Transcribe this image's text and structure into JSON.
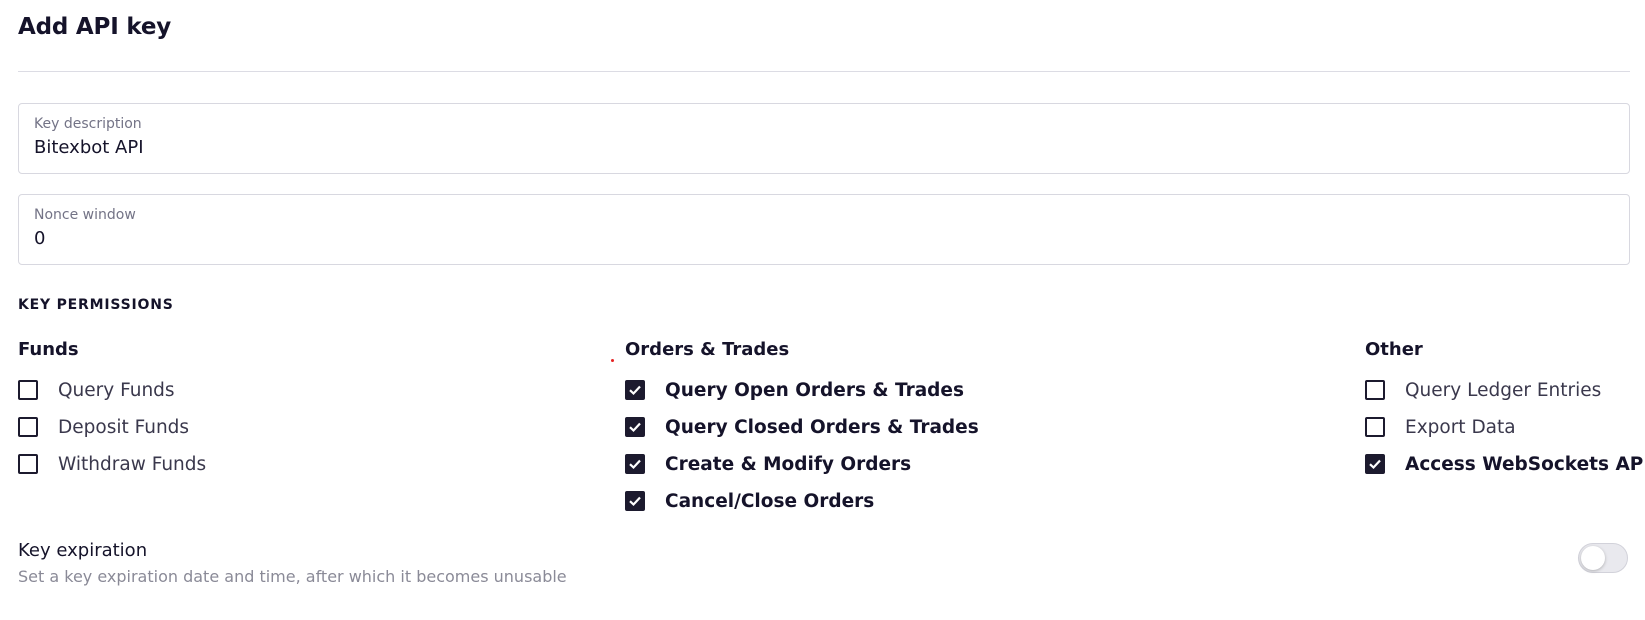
{
  "header": {
    "title": "Add API key"
  },
  "fields": {
    "description": {
      "label": "Key description",
      "value": "Bitexbot API"
    },
    "nonce": {
      "label": "Nonce window",
      "value": "0"
    }
  },
  "permissions": {
    "heading": "KEY PERMISSIONS",
    "groups": [
      {
        "title": "Funds",
        "items": [
          {
            "label": "Query Funds",
            "checked": false
          },
          {
            "label": "Deposit Funds",
            "checked": false
          },
          {
            "label": "Withdraw Funds",
            "checked": false
          }
        ]
      },
      {
        "title": "Orders & Trades",
        "items": [
          {
            "label": "Query Open Orders & Trades",
            "checked": true
          },
          {
            "label": "Query Closed Orders & Trades",
            "checked": true
          },
          {
            "label": "Create & Modify Orders",
            "checked": true
          },
          {
            "label": "Cancel/Close Orders",
            "checked": true
          }
        ]
      },
      {
        "title": "Other",
        "items": [
          {
            "label": "Query Ledger Entries",
            "checked": false
          },
          {
            "label": "Export Data",
            "checked": false
          },
          {
            "label": "Access WebSockets API",
            "checked": true
          }
        ]
      }
    ]
  },
  "expiration": {
    "title": "Key expiration",
    "subtitle": "Set a key expiration date and time, after which it becomes unusable",
    "enabled": false
  },
  "icons": {
    "checkbox_check": "check-icon"
  },
  "colors": {
    "accent": "#1c1a2e",
    "muted": "#8a8a97",
    "border": "#d8d8e0"
  }
}
